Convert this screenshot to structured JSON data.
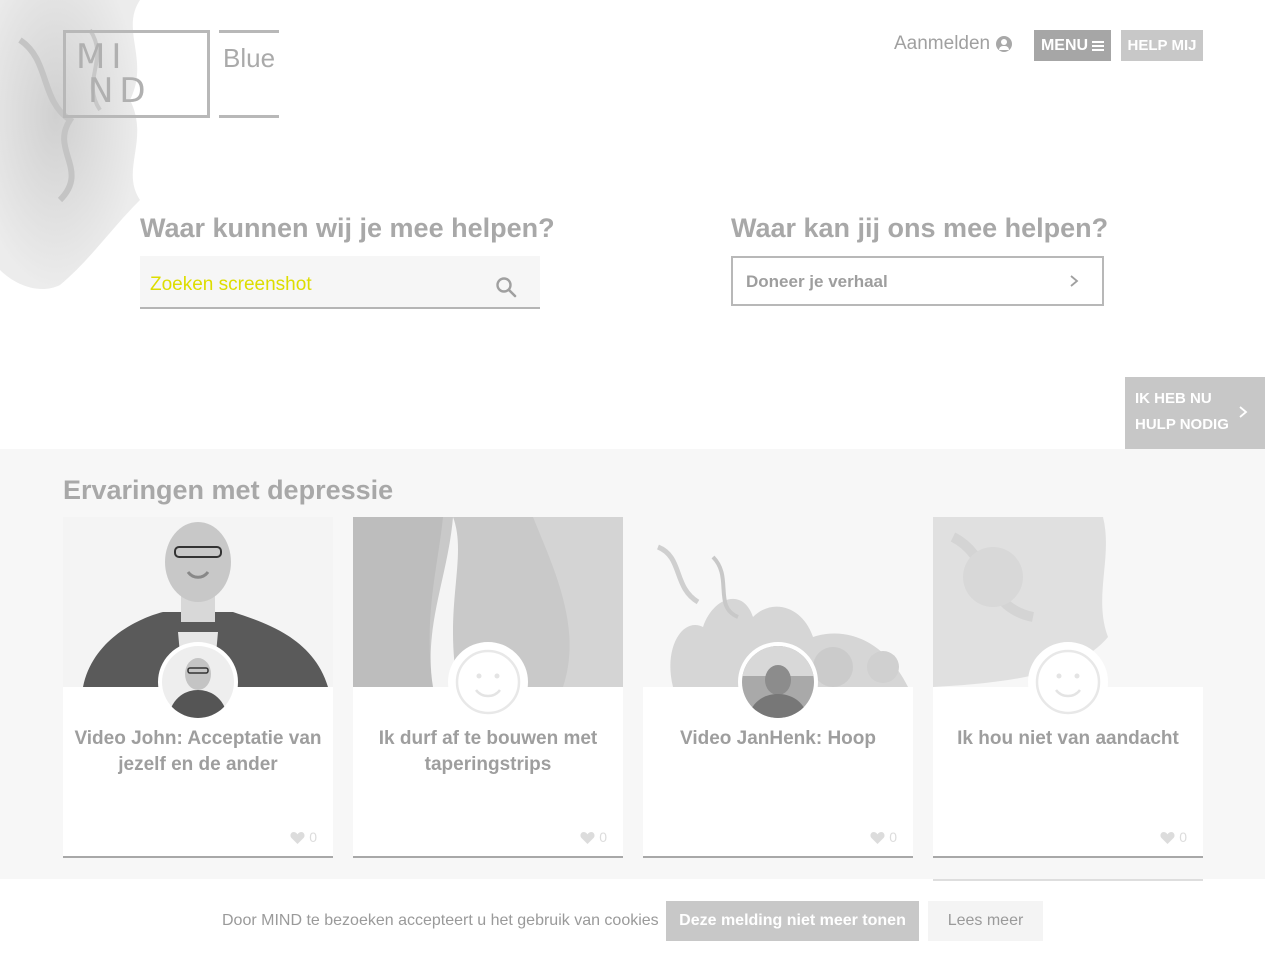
{
  "logo": {
    "line1": "MI",
    "line2": "ND",
    "sub": "Blue"
  },
  "header": {
    "login_label": "Aanmelden",
    "menu_label": "MENU",
    "help_label": "HELP MIJ"
  },
  "left_panel": {
    "heading": "Waar kunnen wij je mee helpen?",
    "search_value": "Zoeken screenshot"
  },
  "right_panel": {
    "heading": "Waar kan jij ons mee helpen?",
    "donate_label": "Doneer je verhaal"
  },
  "side_help": {
    "line1": "IK HEB NU",
    "line2": "HULP NODIG"
  },
  "section": {
    "title": "Ervaringen met depressie",
    "cards": [
      {
        "title": "Video John: Acceptatie van jezelf en de ander",
        "likes": "0"
      },
      {
        "title": "Ik durf af te bouwen met taperingstrips",
        "likes": "0"
      },
      {
        "title": "Video JanHenk: Hoop",
        "likes": "0"
      },
      {
        "title": "Ik hou niet van aandacht",
        "likes": "0"
      }
    ]
  },
  "cookie": {
    "text": "Door MIND te bezoeken accepteert u het gebruik van cookies",
    "accept_label": "Deze melding niet meer tonen",
    "more_label": "Lees meer"
  },
  "colors": {
    "accent_gray": "#a6a6a6",
    "search_text": "#dddd00",
    "background_section": "#f7f7f7"
  }
}
